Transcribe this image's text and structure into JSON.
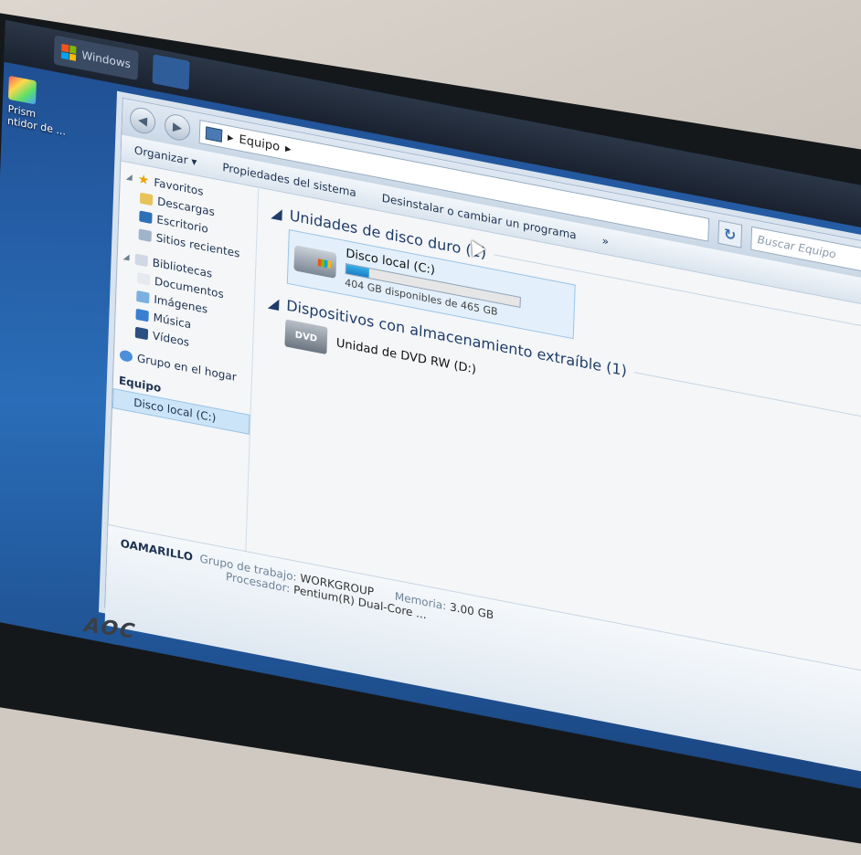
{
  "desktop": {
    "icon_label": "Prism\nntidor de ...",
    "taskbar": {
      "start_label": "Windows"
    }
  },
  "monitor": {
    "brand": "AOC"
  },
  "explorer": {
    "address": {
      "breadcrumb": [
        "Equipo"
      ],
      "separator": "▸"
    },
    "search_placeholder": "Buscar Equipo",
    "refresh_glyph": "↻",
    "overflow_glyph": "»",
    "toolbar": {
      "organize": "Organizar ▾",
      "system_properties": "Propiedades del sistema",
      "uninstall": "Desinstalar o cambiar un programa"
    },
    "nav": {
      "favorites": "Favoritos",
      "downloads": "Descargas",
      "desktop": "Escritorio",
      "recent": "Sitios recientes",
      "libraries": "Bibliotecas",
      "documents": "Documentos",
      "images": "Imágenes",
      "music": "Música",
      "videos": "Vídeos",
      "homegroup": "Grupo en el hogar",
      "computer": "Equipo",
      "local_disk": "Disco local (C:)"
    },
    "groups": {
      "hard_drives": "Unidades de disco duro (1)",
      "removable": "Dispositivos con almacenamiento extraíble (1)"
    },
    "drive_c": {
      "name": "Disco local (C:)",
      "free_text": "404 GB disponibles de 465 GB",
      "used_fraction": 0.13
    },
    "drive_d": {
      "name": "Unidad de DVD RW (D:)",
      "icon_text": "DVD"
    },
    "details": {
      "pc_name": "OAMARILLO",
      "workgroup_label": "Grupo de trabajo:",
      "workgroup_value": "WORKGROUP",
      "memory_label": "Memoria:",
      "memory_value": "3.00 GB",
      "cpu_label": "Procesador:",
      "cpu_value": "Pentium(R) Dual-Core ..."
    }
  }
}
